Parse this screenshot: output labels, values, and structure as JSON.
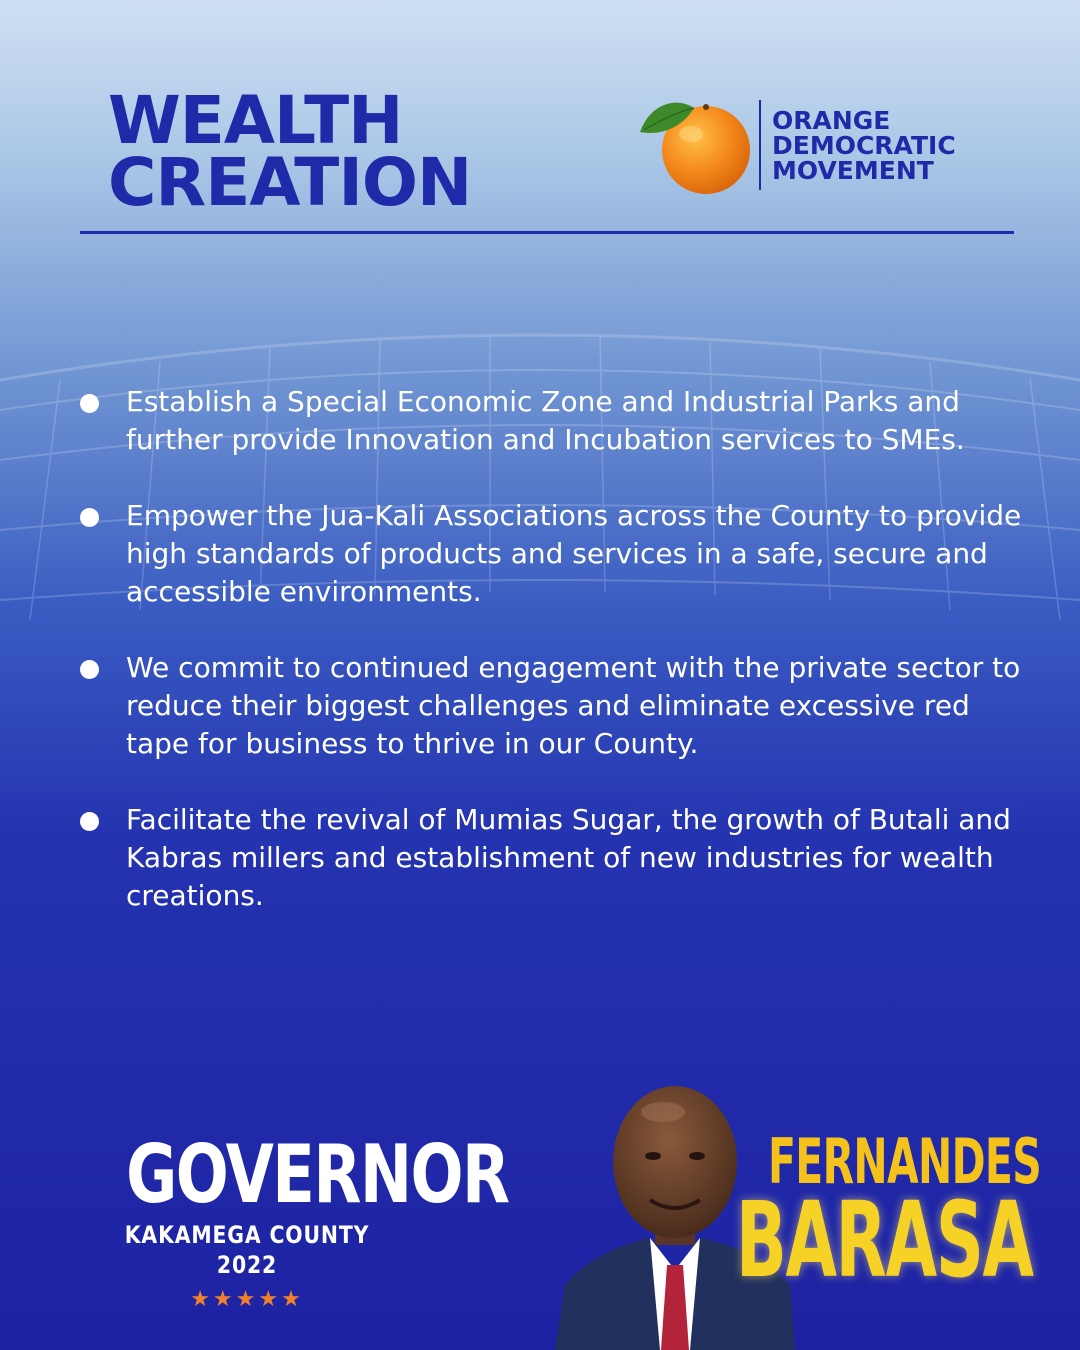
{
  "header": {
    "title_line1": "WEALTH",
    "title_line2": "CREATION"
  },
  "logo": {
    "icon": "orange-fruit-icon",
    "line1": "ORANGE",
    "line2": "DEMOCRATIC",
    "line3": "MOVEMENT"
  },
  "points": [
    {
      "text": "Establish a Special Economic Zone and Industrial Parks and further provide Innovation and Incubation services to SMEs."
    },
    {
      "text": "Empower the Jua-Kali Associations across the County to provide high standards of products and services in a safe, secure and accessible environments."
    },
    {
      "text": "We commit to continued engagement with the private sector to reduce their biggest challenges and eliminate excessive red tape for business to thrive in our County."
    },
    {
      "text": "Facilitate the revival of Mumias Sugar, the growth of Butali and Kabras millers and establishment of new industries for wealth creations."
    }
  ],
  "footer": {
    "office": "GOVERNOR",
    "subtitle": "KAKAMEGA COUNTY 2022",
    "stars": "★★★★★",
    "first_name": "FERNANDES",
    "last_name": "BARASA"
  },
  "colors": {
    "brand_blue": "#1f2aa8",
    "orange": "#f0812a",
    "gold": "#f4c21b",
    "text_light": "#ffffff"
  }
}
